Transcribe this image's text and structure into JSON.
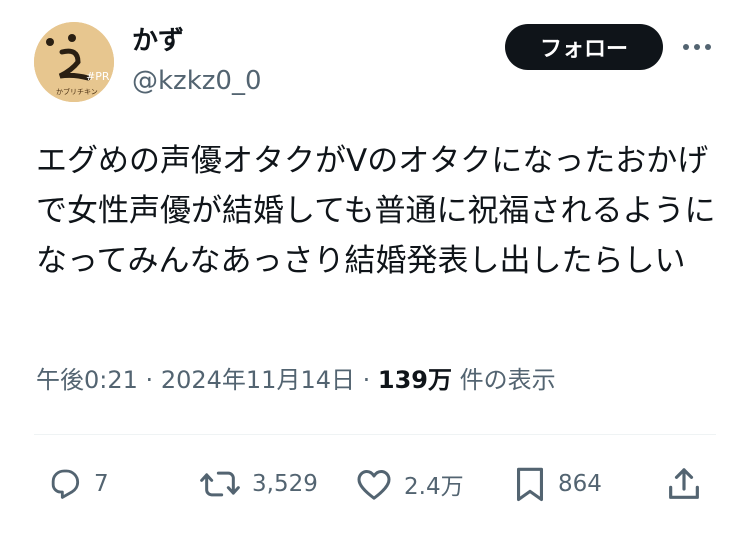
{
  "user": {
    "display_name": "かず",
    "handle": "@kzkz0_0",
    "avatar_label": "#PR",
    "avatar_caption": "かブリチキン"
  },
  "follow_label": "フォロー",
  "tweet": {
    "text": "エグめの声優オタクがVのオタクになったおかげで女性声優が結婚しても普通に祝福されるようになってみんなあっさり結婚発表し出したらしい"
  },
  "meta": {
    "time": "午後0:21",
    "separator": "·",
    "date": "2024年11月14日",
    "views_count": "139万",
    "views_label": "件の表示"
  },
  "actions": {
    "replies": "7",
    "retweets": "3,529",
    "likes": "2.4万",
    "bookmarks": "864"
  },
  "icons": {
    "reply": "reply-icon",
    "retweet": "retweet-icon",
    "like": "heart-icon",
    "bookmark": "bookmark-icon",
    "share": "share-icon",
    "more": "more-icon"
  },
  "colors": {
    "text": "#0f1419",
    "secondary": "#536471",
    "button_bg": "#0f1419",
    "avatar_bg": "#e7c68f"
  }
}
